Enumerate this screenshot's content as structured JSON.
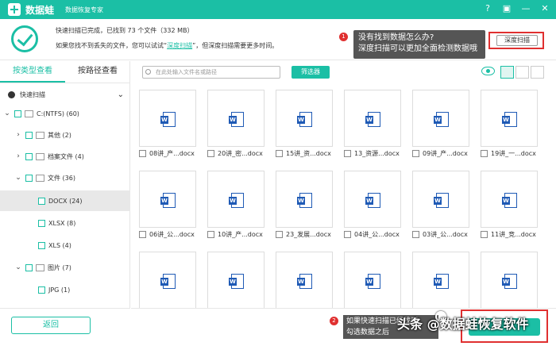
{
  "titlebar": {
    "app_name": "数据蛙",
    "subtitle": "数据恢复专家",
    "help": "?",
    "save": "▣",
    "min": "—",
    "close": "✕"
  },
  "header": {
    "status": "快速扫描已完成，已找到  73  个文件（332 MB）",
    "hint_prefix": "如果您找不到丢失的文件，您可以试试“",
    "deep_link": "深度扫描",
    "hint_suffix": "”，但深度扫描需要更多时间。",
    "tip_badge": "1",
    "tip_line1": "没有找到数据怎么办?",
    "tip_line2": "深度扫描可以更加全面检测数据哦",
    "deep_button": "深度扫描"
  },
  "sidebar": {
    "tab_type": "按类型查看",
    "tab_path": "按路径查看",
    "scan_label": "快速扫描",
    "items": [
      {
        "label": "C:(NTFS) (60)"
      },
      {
        "label": "其他 (2)"
      },
      {
        "label": "档案文件 (4)"
      },
      {
        "label": "文件 (36)"
      },
      {
        "label": "DOCX (24)"
      },
      {
        "label": "XLSX (8)"
      },
      {
        "label": "XLS (4)"
      },
      {
        "label": "图片 (7)"
      },
      {
        "label": "JPG (1)"
      }
    ],
    "back_button": "返回"
  },
  "toolbar": {
    "search_placeholder": "在此处输入文件名或路径",
    "filter_button": "筛选器"
  },
  "files": [
    {
      "name": "08讲_产...docx"
    },
    {
      "name": "20讲_密...docx"
    },
    {
      "name": "15讲_资...docx"
    },
    {
      "name": "13_资源...docx"
    },
    {
      "name": "09讲_产...docx"
    },
    {
      "name": "19讲_一...docx"
    },
    {
      "name": "06讲_公...docx"
    },
    {
      "name": "10讲_产...docx"
    },
    {
      "name": "23_发展...docx"
    },
    {
      "name": "04讲_公...docx"
    },
    {
      "name": "03讲_公...docx"
    },
    {
      "name": "11讲_竞...docx"
    },
    {
      "name": ""
    },
    {
      "name": ""
    },
    {
      "name": ""
    },
    {
      "name": ""
    },
    {
      "name": ""
    },
    {
      "name": ""
    }
  ],
  "footer": {
    "tip_badge": "2",
    "tip_line1": "如果快速扫描已经找到",
    "tip_line2": "勾选数据之后",
    "watermark": "头条 @数据蛙恢复软件"
  },
  "colors": {
    "accent": "#1bbfa5",
    "highlight": "#e03030"
  }
}
